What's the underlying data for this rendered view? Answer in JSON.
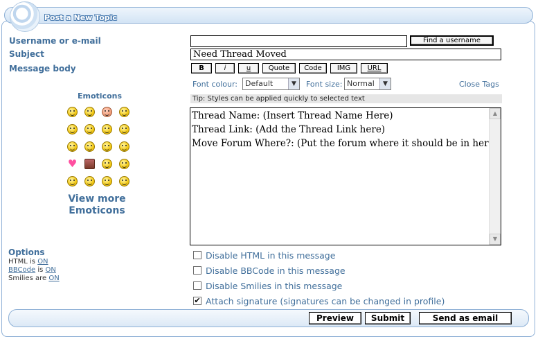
{
  "header": {
    "title": "Post a New Topic"
  },
  "form": {
    "username_label": "Username or e-mail",
    "username_value": "",
    "find_username_label": "Find a username",
    "subject_label": "Subject",
    "subject_value": "Need Thread Moved",
    "message_label": "Message body",
    "format_buttons": {
      "bold": "B",
      "italic": "i",
      "underline": "u",
      "quote": "Quote",
      "code": "Code",
      "img": "IMG",
      "url": "URL"
    },
    "font_colour_label": "Font colour:",
    "font_colour_value": "Default",
    "font_size_label": "Font size:",
    "font_size_value": "Normal",
    "close_tags": "Close Tags",
    "tip": "Tip: Styles can be applied quickly to selected text",
    "message_lines": [
      "Thread Name: (Insert Thread Name Here)",
      "Thread Link: (Add the Thread Link here)",
      "Move Forum Where?: (Put the forum where it should be in here)"
    ]
  },
  "emoticons": {
    "title": "Emoticons",
    "view_more_line1": "View more",
    "view_more_line2": "Emoticons",
    "icons": [
      "very-happy-icon",
      "smile-icon",
      "sad-icon",
      "crying-icon",
      "confused-icon",
      "laughing-icon",
      "neutral-icon",
      "razz-icon",
      "evil-icon",
      "twisted-icon",
      "surprised-icon",
      "shocked-icon",
      "heart-icon",
      "calendar-icon",
      "wink-icon",
      "cool-icon",
      "smile-icon",
      "sad-icon",
      "surprised-icon",
      "eek-icon"
    ]
  },
  "options": {
    "title": "Options",
    "html_label": "HTML is ",
    "html_state": "ON",
    "bbcode_link": "BBCode",
    "bbcode_label": " is ",
    "bbcode_state": "ON",
    "smilies_label": "Smilies are ",
    "smilies_state": "ON"
  },
  "checkboxes": [
    {
      "label": "Disable HTML in this message",
      "checked": false
    },
    {
      "label": "Disable BBCode in this message",
      "checked": false
    },
    {
      "label": "Disable Smilies in this message",
      "checked": false
    },
    {
      "label": "Attach signature (signatures can be changed in profile)",
      "checked": true
    }
  ],
  "footer": {
    "preview": "Preview",
    "submit": "Submit",
    "send_email": "Send as email"
  }
}
